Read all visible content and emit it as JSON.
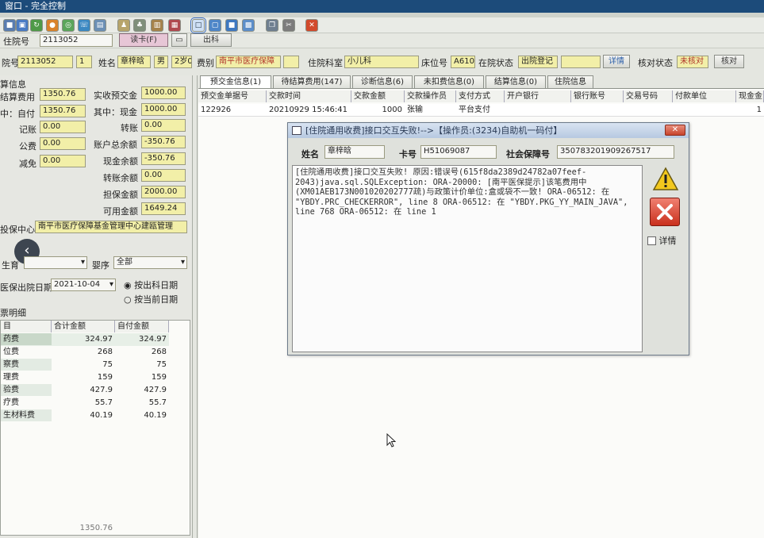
{
  "window": {
    "title": "窗口 - 完全控制"
  },
  "row1": {
    "label": "住院号",
    "value": "2113052",
    "btn_read": "读卡(F)",
    "btn_out": "出科"
  },
  "row2": {
    "inpatient_no_label": "院号",
    "inpatient_no": "2113052",
    "times": "1",
    "name_label": "姓名",
    "name": "章梓晗",
    "sex": "男",
    "age": "2岁0",
    "category_label": "费别",
    "category": "南平市医疗保障",
    "dept_label": "住院科室",
    "dept": "小儿科",
    "bed_label": "床位号",
    "bed": "A6105",
    "status_label": "在院状态",
    "status": "出院登记",
    "detail_btn": "详情",
    "check_label": "核对状态",
    "check_value": "未核对",
    "check_btn": "核对"
  },
  "settle": {
    "header": "算信息",
    "items_left": [
      {
        "label": "结算费用",
        "value": "1350.76"
      },
      {
        "label": "中：自付",
        "value": "1350.76"
      },
      {
        "label": "记账",
        "value": "0.00"
      },
      {
        "label": "公费",
        "value": "0.00"
      },
      {
        "label": "减免",
        "value": "0.00"
      }
    ],
    "items_right": [
      {
        "label": "实收预交金",
        "value": "1000.00"
      },
      {
        "label": "其中：现金",
        "value": "1000.00"
      },
      {
        "label": "转账",
        "value": "0.00"
      },
      {
        "label": "账户总余额",
        "value": "-350.76"
      },
      {
        "label": "现金余额",
        "value": "-350.76"
      },
      {
        "label": "转账余额",
        "value": "0.00"
      },
      {
        "label": "担保金额",
        "value": "2000.00"
      },
      {
        "label": "可用金额",
        "value": "1649.24"
      }
    ]
  },
  "insurance": {
    "label": "投保中心",
    "value": "南平市医疗保障基金管理中心建瓯管理"
  },
  "filters": {
    "project_label": "生育",
    "baby_label": "婴序",
    "baby_value": "全部",
    "discharge_label": "医保出院日期",
    "discharge_date": "2021-10-04",
    "radio1": "按出科日期",
    "radio2": "按当前日期"
  },
  "invoice": {
    "header": "票明细",
    "columns": [
      "目",
      "合计金额",
      "自付金额"
    ],
    "rows": [
      [
        "药费",
        "324.97",
        "324.97"
      ],
      [
        "位费",
        "268",
        "268"
      ],
      [
        "察费",
        "75",
        "75"
      ],
      [
        "理费",
        "159",
        "159"
      ],
      [
        "验费",
        "427.9",
        "427.9"
      ],
      [
        "疗费",
        "55.7",
        "55.7"
      ],
      [
        "生材料费",
        "40.19",
        "40.19"
      ]
    ],
    "footer": "1350.76"
  },
  "tabs": [
    {
      "label": "预交金信息(1)",
      "active": true
    },
    {
      "label": "待结算费用(147)"
    },
    {
      "label": "诊断信息(6)"
    },
    {
      "label": "未扣费信息(0)"
    },
    {
      "label": "结算信息(0)"
    },
    {
      "label": "住院信息"
    }
  ],
  "grid": {
    "columns": [
      "预交金单据号",
      "交款时间",
      "交款金额",
      "交款操作员",
      "支付方式",
      "开户银行",
      "银行账号",
      "交易号码",
      "付款单位",
      "现金金"
    ],
    "rows": [
      [
        "122926",
        "20210929 15:46:41",
        "1000",
        "张输",
        "平台支付",
        "",
        "",
        "",
        "",
        "1"
      ]
    ]
  },
  "dialog": {
    "title": "[住院通用收费]接口交互失败!-->【操作员:(3234)自助机一码付】",
    "close": "✕",
    "name_label": "姓名",
    "name": "章梓晗",
    "card_label": "卡号",
    "card": "H51069087",
    "ssn_label": "社会保障号",
    "ssn": "350783201909267517",
    "message": "[住院通用收费]接口交互失败! 原因:错误号(615f8da2389d24782a07feef-2043)java.sql.SQLException: ORA-20000: [南平医保提示]该笔费用中(XM01AEB173N001020202777疏)与政策计价单位:盒或袋不一致! ORA-06512: 在 \"YBDY.PRC_CHECKERROR\", line 8 ORA-06512: 在 \"YBDY.PKG_YY_MAIN_JAVA\", line 768 ORA-06512: 在 line 1",
    "detail_checkbox": "详情"
  }
}
